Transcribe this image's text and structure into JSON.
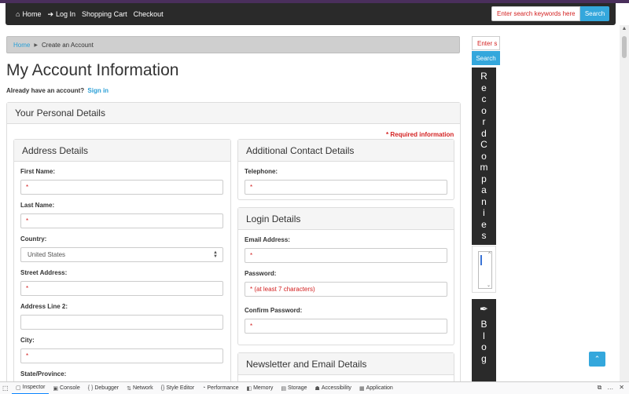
{
  "navbar": {
    "items": [
      {
        "label": "Home",
        "icon": "home-icon"
      },
      {
        "label": "Log In",
        "icon": "sign-in-icon"
      },
      {
        "label": "Shopping Cart",
        "icon": ""
      },
      {
        "label": "Checkout",
        "icon": ""
      }
    ],
    "search_placeholder": "Enter search keywords here",
    "search_button": "Search"
  },
  "breadcrumb": {
    "home": "Home",
    "current": "Create an Account"
  },
  "page_title": "My Account Information",
  "already": {
    "text": "Already have an account?",
    "link": "Sign in"
  },
  "personal_panel": {
    "title": "Your Personal Details",
    "required_note": "* Required information"
  },
  "address": {
    "title": "Address Details",
    "first_name": {
      "label": "First Name:",
      "value": "*"
    },
    "last_name": {
      "label": "Last Name:",
      "value": "*"
    },
    "country": {
      "label": "Country:",
      "value": "United States"
    },
    "street": {
      "label": "Street Address:",
      "value": "*"
    },
    "line2": {
      "label": "Address Line 2:",
      "value": ""
    },
    "city": {
      "label": "City:",
      "value": "*"
    },
    "state": {
      "label": "State/Province:"
    }
  },
  "contact": {
    "title": "Additional Contact Details",
    "telephone": {
      "label": "Telephone:",
      "value": "*"
    }
  },
  "login": {
    "title": "Login Details",
    "email": {
      "label": "Email Address:",
      "value": "*"
    },
    "password": {
      "label": "Password:",
      "value": "* (at least 7 characters)"
    },
    "confirm": {
      "label": "Confirm Password:",
      "value": "*"
    }
  },
  "newsletter": {
    "title": "Newsletter and Email Details"
  },
  "sidebar": {
    "search_placeholder": "Enter s",
    "search_button": "Search",
    "record_companies": [
      "R",
      "e",
      "c",
      "o",
      "r",
      "d",
      "C",
      "o",
      "m",
      "p",
      "a",
      "n",
      "i",
      "e",
      "s"
    ],
    "blog": [
      "B",
      "l",
      "o",
      "g"
    ]
  },
  "devtools": {
    "tabs": [
      {
        "label": "Inspector",
        "icon": "inspector-icon"
      },
      {
        "label": "Console",
        "icon": "console-icon"
      },
      {
        "label": "Debugger",
        "icon": "debugger-icon"
      },
      {
        "label": "Network",
        "icon": "network-icon"
      },
      {
        "label": "Style Editor",
        "icon": "style-editor-icon"
      },
      {
        "label": "Performance",
        "icon": "performance-icon"
      },
      {
        "label": "Memory",
        "icon": "memory-icon"
      },
      {
        "label": "Storage",
        "icon": "storage-icon"
      },
      {
        "label": "Accessibility",
        "icon": "accessibility-icon"
      },
      {
        "label": "Application",
        "icon": "application-icon"
      }
    ]
  },
  "colors": {
    "accent": "#34a7dc",
    "navbar": "#2a2a2a",
    "required": "#d32020"
  }
}
